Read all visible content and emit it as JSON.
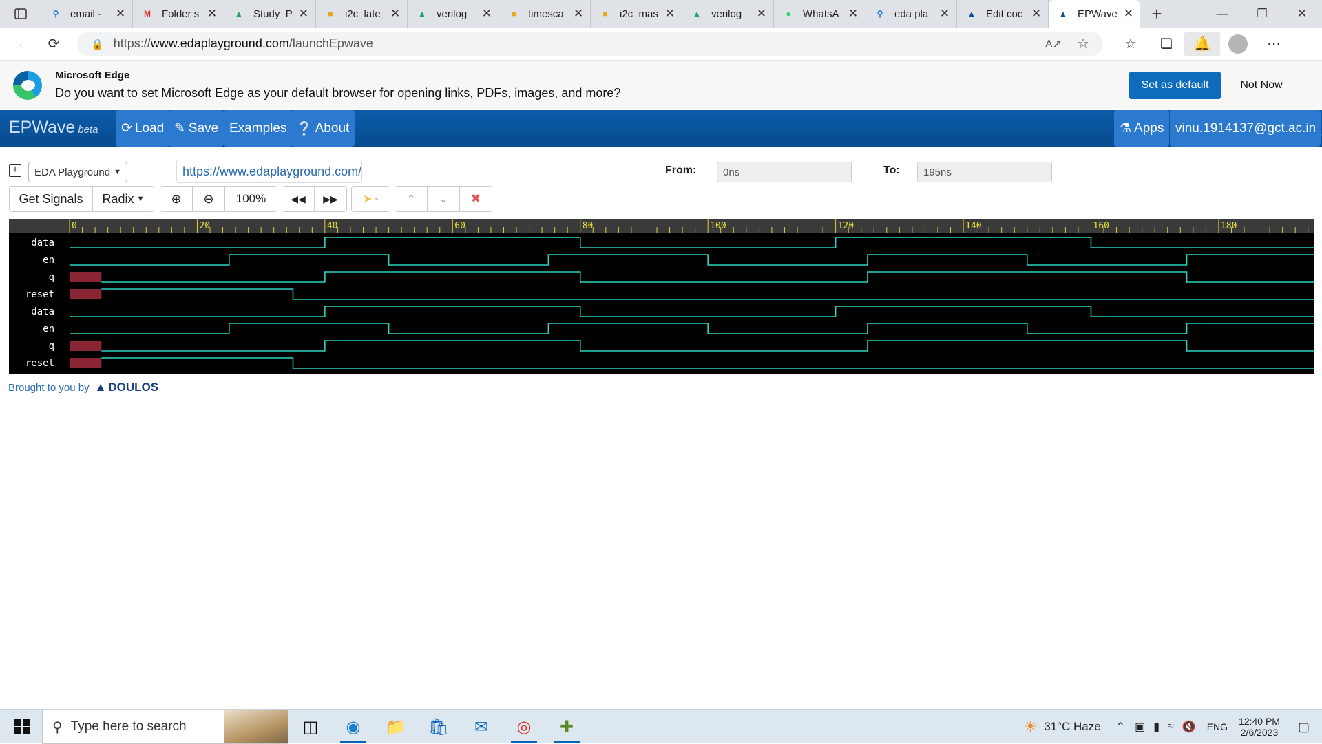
{
  "browser": {
    "tabs": [
      {
        "title": "email -",
        "icon": "search-icon",
        "active": false
      },
      {
        "title": "Folder s",
        "icon": "gmail-icon",
        "active": false
      },
      {
        "title": "Study_P",
        "icon": "drive-icon",
        "active": false
      },
      {
        "title": "i2c_late",
        "icon": "folder-icon",
        "active": false
      },
      {
        "title": "verilog",
        "icon": "drive-icon",
        "active": false
      },
      {
        "title": "timesca",
        "icon": "folder-icon",
        "active": false
      },
      {
        "title": "i2c_mas",
        "icon": "folder-icon",
        "active": false
      },
      {
        "title": "verilog",
        "icon": "drive-icon",
        "active": false
      },
      {
        "title": "WhatsA",
        "icon": "whatsapp-icon",
        "active": false
      },
      {
        "title": "eda pla",
        "icon": "search-icon",
        "active": false
      },
      {
        "title": "Edit coc",
        "icon": "eda-icon",
        "active": false
      },
      {
        "title": "EPWave",
        "icon": "eda-icon",
        "active": true
      }
    ],
    "url_prefix": "https://",
    "url_host": "www.edaplayground.com",
    "url_path": "/launchEpwave"
  },
  "infobar": {
    "title": "Microsoft Edge",
    "message": "Do you want to set Microsoft Edge as your default browser for opening links, PDFs, images, and more?",
    "primary_label": "Set as default",
    "secondary_label": "Not Now"
  },
  "epwave": {
    "brand": "EPWave",
    "brand_tag": "beta",
    "nav": {
      "load": "Load",
      "save": "Save",
      "examples": "Examples",
      "about": "About",
      "apps": "Apps",
      "user": "vinu.1914137@gct.ac.in"
    },
    "source_select": "EDA Playground",
    "source_url": "https://www.edaplayground.com/",
    "from_label": "From:",
    "from_value": "0ns",
    "to_label": "To:",
    "to_value": "195ns",
    "toolbar": {
      "get_signals": "Get Signals",
      "radix": "Radix",
      "zoom": "100%",
      "marker": "-"
    },
    "credits": "Brought to you by",
    "credits_brand": "DOULOS"
  },
  "waveform": {
    "time_range": [
      0,
      195
    ],
    "tick_labels": [
      "0",
      "20",
      "40",
      "60",
      "80",
      "100",
      "120",
      "140",
      "160",
      "180"
    ],
    "signals": [
      {
        "name": "data",
        "start": 0,
        "edges": [
          40,
          80,
          120,
          160
        ],
        "unknown_until": null
      },
      {
        "name": "en",
        "start": 0,
        "edges": [
          25,
          50,
          75,
          100,
          125,
          150,
          175
        ],
        "unknown_until": null
      },
      {
        "name": "q",
        "start": 0,
        "edges": [
          40,
          80,
          125,
          175
        ],
        "unknown_until": 5
      },
      {
        "name": "reset",
        "start": 1,
        "edges": [
          35
        ],
        "unknown_until": 5
      },
      {
        "name": "data",
        "start": 0,
        "edges": [
          40,
          80,
          120,
          160
        ],
        "unknown_until": null
      },
      {
        "name": "en",
        "start": 0,
        "edges": [
          25,
          50,
          75,
          100,
          125,
          150,
          175
        ],
        "unknown_until": null
      },
      {
        "name": "q",
        "start": 0,
        "edges": [
          40,
          80,
          125,
          175
        ],
        "unknown_until": 5
      },
      {
        "name": "reset",
        "start": 1,
        "edges": [
          35
        ],
        "unknown_until": 5
      }
    ]
  },
  "taskbar": {
    "search_placeholder": "Type here to search",
    "weather": "31°C  Haze",
    "language": "ENG",
    "time": "12:40 PM",
    "date": "2/6/2023"
  }
}
